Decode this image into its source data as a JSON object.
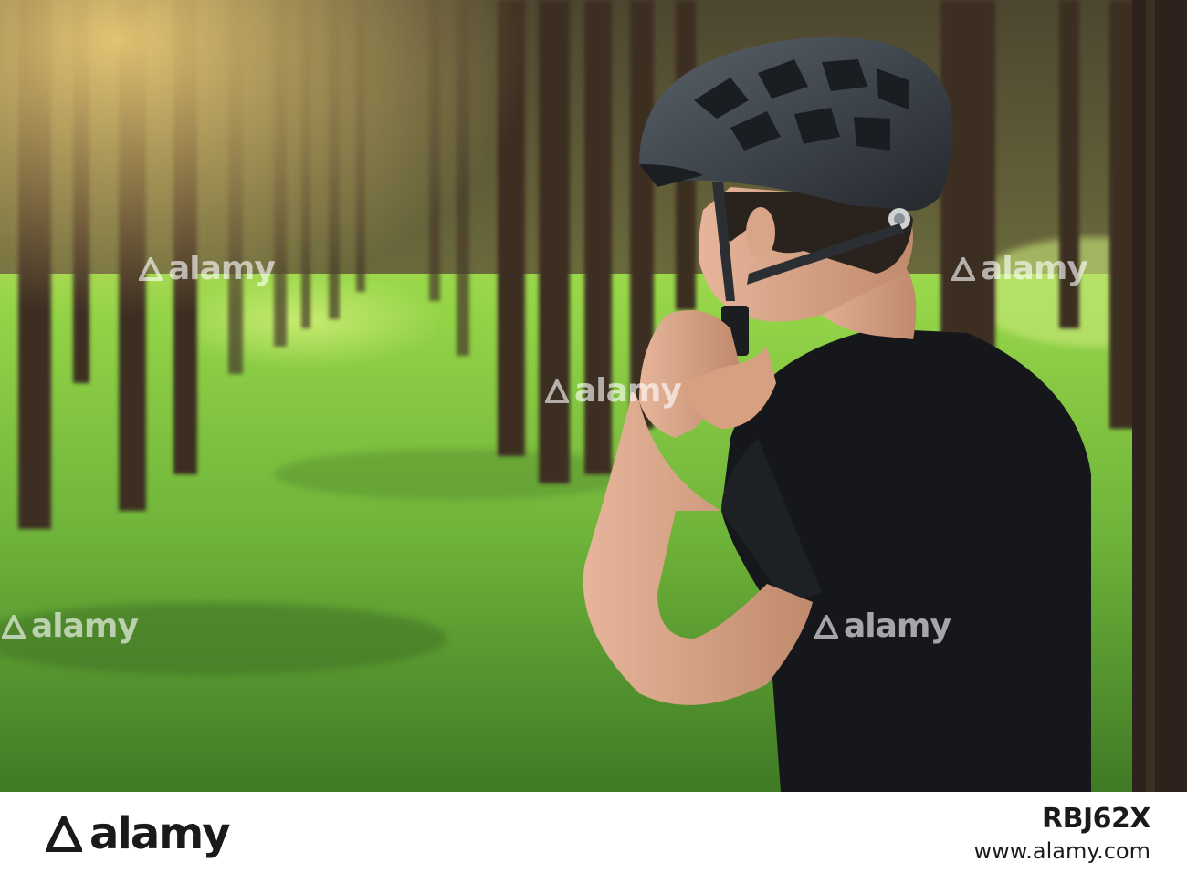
{
  "watermark": {
    "text": "alamy"
  },
  "footer": {
    "logo_text": "alamy",
    "image_id": "RBJ62X",
    "url": "www.alamy.com"
  },
  "colors": {
    "shirt": "#15171b",
    "helmet": "#3a4046",
    "grass": "#7fc23a",
    "trunk": "#3a2a22"
  }
}
